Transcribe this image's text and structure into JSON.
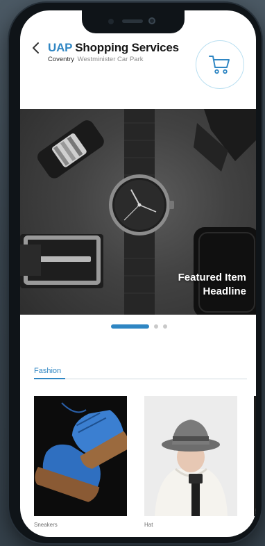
{
  "header": {
    "brand": "UAP",
    "title": "Shopping Services",
    "location_city": "Coventry",
    "location_detail": "Westminister Car Park"
  },
  "icons": {
    "back": "chevron-left-icon",
    "cart": "shopping-cart-icon"
  },
  "hero": {
    "headline_line1": "Featured Item",
    "headline_line2": "Headline",
    "image": "watch-belt-accessories-photo"
  },
  "carousel": {
    "slides": 3,
    "active_index": 0
  },
  "tabs": [
    {
      "label": "Fashion",
      "active": true
    }
  ],
  "products": [
    {
      "label": "Sneakers",
      "image": "blue-sneakers-photo"
    },
    {
      "label": "Hat",
      "image": "grey-fedora-hat-photo"
    }
  ],
  "colors": {
    "accent": "#2f86c3",
    "ring": "#b9dff1"
  }
}
